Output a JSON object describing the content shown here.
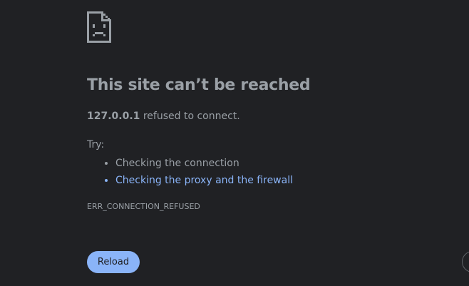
{
  "error": {
    "icon": "sad-page-icon",
    "title": "This site can’t be reached",
    "host": "127.0.0.1",
    "summary_suffix": " refused to connect.",
    "try_label": "Try:",
    "suggestions": [
      {
        "label": "Checking the connection",
        "is_link": false
      },
      {
        "label": "Checking the proxy and the firewall",
        "is_link": true
      }
    ],
    "code": "ERR_CONNECTION_REFUSED"
  },
  "actions": {
    "reload_label": "Reload",
    "details_label": ""
  },
  "colors": {
    "background": "#202124",
    "text": "#9aa0a6",
    "link": "#8ab4f8",
    "button_bg": "#8ab4f8",
    "button_text": "#202124"
  }
}
